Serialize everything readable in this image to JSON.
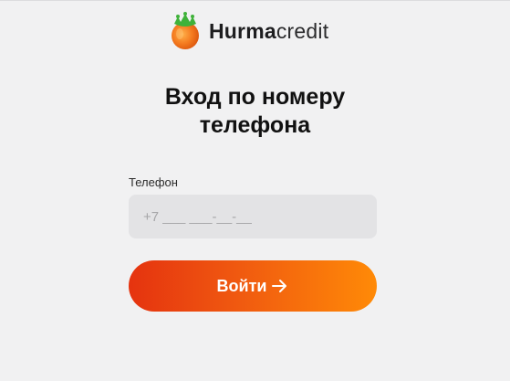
{
  "brand": {
    "name_bold": "Hurma",
    "name_light": "credit",
    "logo_icon": "persimmon-icon"
  },
  "title": {
    "line1": "Вход по номеру",
    "line2": "телефона"
  },
  "phone_field": {
    "label": "Телефон",
    "value": "",
    "placeholder": "+7 ___ ___-__-__"
  },
  "submit_button": {
    "label": "Войти",
    "icon": "arrow-right-icon"
  },
  "colors": {
    "background": "#f1f1f2",
    "button_gradient_start": "#e5330f",
    "button_gradient_end": "#ff8a07",
    "input_background": "#e3e3e5",
    "leaf_green": "#3fb23a",
    "fruit_orange": "#f47a1f"
  }
}
